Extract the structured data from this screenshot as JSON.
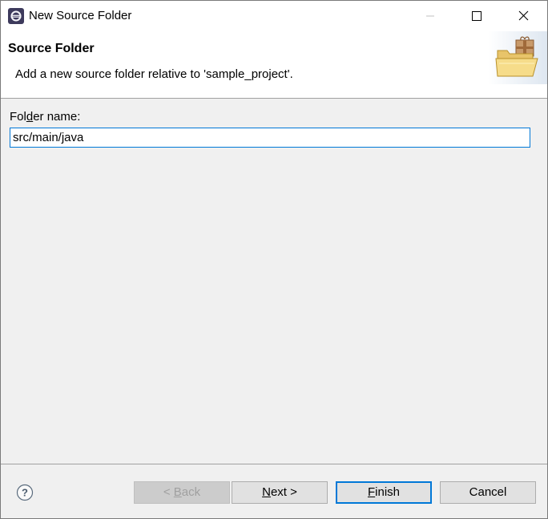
{
  "window": {
    "title": "New Source Folder",
    "app_icon": "eclipse-icon",
    "controls": {
      "minimize_icon": "minimize-icon",
      "maximize_icon": "maximize-icon",
      "close_icon": "close-icon"
    }
  },
  "header": {
    "title": "Source Folder",
    "description": "Add a new source folder relative to 'sample_project'.",
    "graphic_icon": "folder-package-icon"
  },
  "form": {
    "folder_label_pre": "Fol",
    "folder_label_mnemonic": "d",
    "folder_label_post": "er name:",
    "folder_value": "src/main/java"
  },
  "footer": {
    "help_icon": "help-icon",
    "back": {
      "prefix": "< ",
      "mnemonic": "B",
      "rest": "ack",
      "enabled": false
    },
    "next": {
      "mnemonic": "N",
      "rest": "ext >",
      "enabled": true
    },
    "finish": {
      "mnemonic": "F",
      "rest": "inish",
      "enabled": true,
      "default": true
    },
    "cancel": {
      "label": "Cancel",
      "enabled": true
    }
  },
  "colors": {
    "accent": "#0078d7",
    "dialog_bg": "#f0f0f0",
    "header_bg": "#ffffff"
  }
}
